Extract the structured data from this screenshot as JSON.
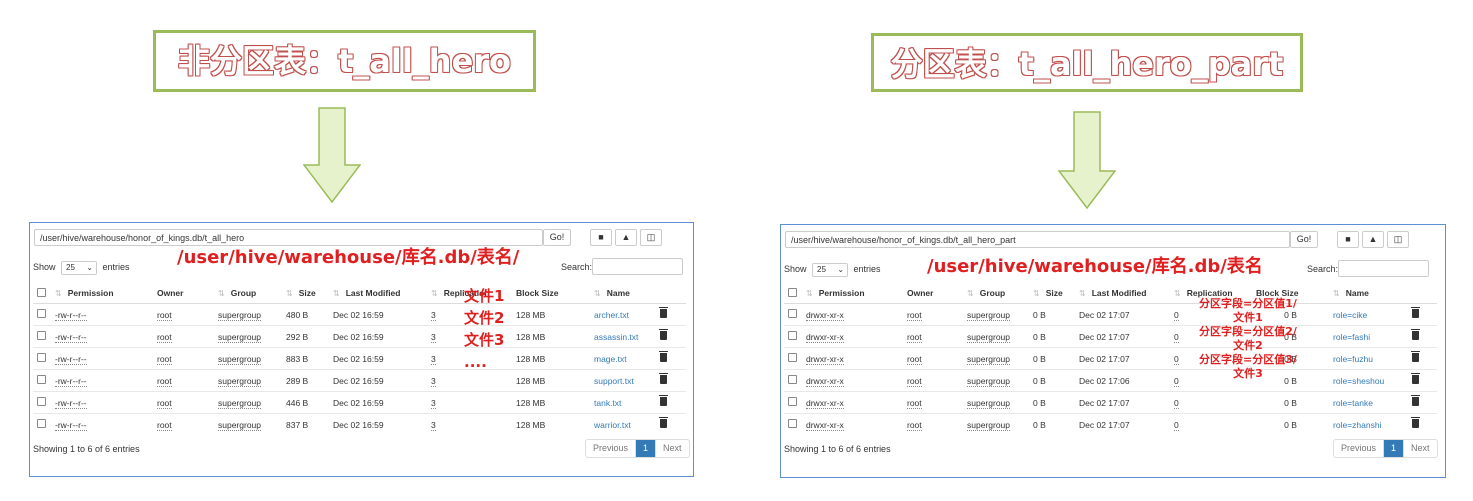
{
  "left": {
    "title": "非分区表：t_all_hero",
    "path": "/user/hive/warehouse/honor_of_kings.db/t_all_hero",
    "go_label": "Go!",
    "show_label": "Show",
    "show_value": "25",
    "entries_label": "entries",
    "search_label": "Search:",
    "annotation_path": "/user/hive/warehouse/库名.db/表名/",
    "annotation_files": [
      "文件1",
      "文件2",
      "文件3",
      "...."
    ],
    "headers": [
      "Permission",
      "Owner",
      "Group",
      "Size",
      "Last Modified",
      "Replication",
      "Block Size",
      "Name"
    ],
    "rows": [
      {
        "permission": "-rw-r--r--",
        "owner": "root",
        "group": "supergroup",
        "size": "480 B",
        "modified": "Dec 02 16:59",
        "replication": "3",
        "block": "128 MB",
        "name": "archer.txt"
      },
      {
        "permission": "-rw-r--r--",
        "owner": "root",
        "group": "supergroup",
        "size": "292 B",
        "modified": "Dec 02 16:59",
        "replication": "3",
        "block": "128 MB",
        "name": "assassin.txt"
      },
      {
        "permission": "-rw-r--r--",
        "owner": "root",
        "group": "supergroup",
        "size": "883 B",
        "modified": "Dec 02 16:59",
        "replication": "3",
        "block": "128 MB",
        "name": "mage.txt"
      },
      {
        "permission": "-rw-r--r--",
        "owner": "root",
        "group": "supergroup",
        "size": "289 B",
        "modified": "Dec 02 16:59",
        "replication": "3",
        "block": "128 MB",
        "name": "support.txt"
      },
      {
        "permission": "-rw-r--r--",
        "owner": "root",
        "group": "supergroup",
        "size": "446 B",
        "modified": "Dec 02 16:59",
        "replication": "3",
        "block": "128 MB",
        "name": "tank.txt"
      },
      {
        "permission": "-rw-r--r--",
        "owner": "root",
        "group": "supergroup",
        "size": "837 B",
        "modified": "Dec 02 16:59",
        "replication": "3",
        "block": "128 MB",
        "name": "warrior.txt"
      }
    ],
    "footer": "Showing 1 to 6 of 6 entries",
    "pager": {
      "previous": "Previous",
      "current": "1",
      "next": "Next"
    }
  },
  "right": {
    "title": "分区表：t_all_hero_part",
    "path": "/user/hive/warehouse/honor_of_kings.db/t_all_hero_part",
    "go_label": "Go!",
    "show_label": "Show",
    "show_value": "25",
    "entries_label": "entries",
    "search_label": "Search:",
    "annotation_path": "/user/hive/warehouse/库名.db/表名",
    "annotation_parts": [
      "分区字段=分区值1/",
      "文件1",
      "分区字段=分区值2/",
      "文件2",
      "分区字段=分区值3/",
      "文件3"
    ],
    "headers": [
      "Permission",
      "Owner",
      "Group",
      "Size",
      "Last Modified",
      "Replication",
      "Block Size",
      "Name"
    ],
    "rows": [
      {
        "permission": "drwxr-xr-x",
        "owner": "root",
        "group": "supergroup",
        "size": "0 B",
        "modified": "Dec 02 17:07",
        "replication": "0",
        "block": "0 B",
        "name": "role=cike"
      },
      {
        "permission": "drwxr-xr-x",
        "owner": "root",
        "group": "supergroup",
        "size": "0 B",
        "modified": "Dec 02 17:07",
        "replication": "0",
        "block": "0 B",
        "name": "role=fashi"
      },
      {
        "permission": "drwxr-xr-x",
        "owner": "root",
        "group": "supergroup",
        "size": "0 B",
        "modified": "Dec 02 17:07",
        "replication": "0",
        "block": "0 B",
        "name": "role=fuzhu"
      },
      {
        "permission": "drwxr-xr-x",
        "owner": "root",
        "group": "supergroup",
        "size": "0 B",
        "modified": "Dec 02 17:06",
        "replication": "0",
        "block": "0 B",
        "name": "role=sheshou"
      },
      {
        "permission": "drwxr-xr-x",
        "owner": "root",
        "group": "supergroup",
        "size": "0 B",
        "modified": "Dec 02 17:07",
        "replication": "0",
        "block": "0 B",
        "name": "role=tanke"
      },
      {
        "permission": "drwxr-xr-x",
        "owner": "root",
        "group": "supergroup",
        "size": "0 B",
        "modified": "Dec 02 17:07",
        "replication": "0",
        "block": "0 B",
        "name": "role=zhanshi"
      }
    ],
    "footer": "Showing 1 to 6 of 6 entries",
    "pager": {
      "previous": "Previous",
      "current": "1",
      "next": "Next"
    }
  },
  "colors": {
    "accent_green": "#9bbb59",
    "annotation_red": "#e02020",
    "link_blue": "#337ab7",
    "panel_border": "#5b8fd6"
  }
}
